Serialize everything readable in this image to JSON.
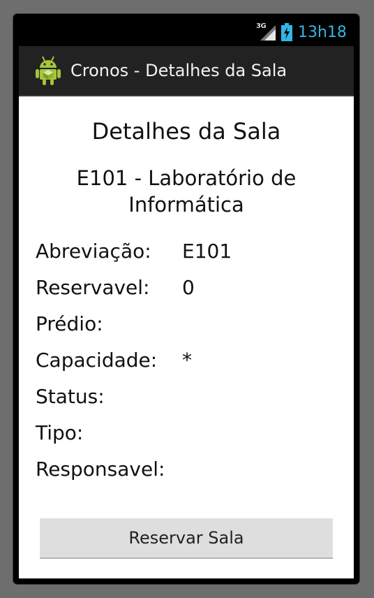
{
  "status_bar": {
    "network": "3G",
    "time": "13h18",
    "time_color": "#33b5e5"
  },
  "action_bar": {
    "icon": "android-icon",
    "title": "Cronos - Detalhes da Sala"
  },
  "main": {
    "heading": "Detalhes da Sala",
    "room_name": "E101 - Laboratório de Informática",
    "details": [
      {
        "label": "Abreviação:",
        "value": "E101"
      },
      {
        "label": "Reservavel:",
        "value": "0"
      },
      {
        "label": "Prédio:",
        "value": ""
      },
      {
        "label": "Capacidade:",
        "value": "*"
      },
      {
        "label": "Status:",
        "value": ""
      },
      {
        "label": "Tipo:",
        "value": ""
      },
      {
        "label": "Responsavel:",
        "value": ""
      }
    ],
    "reserve_button_label": "Reservar Sala"
  }
}
